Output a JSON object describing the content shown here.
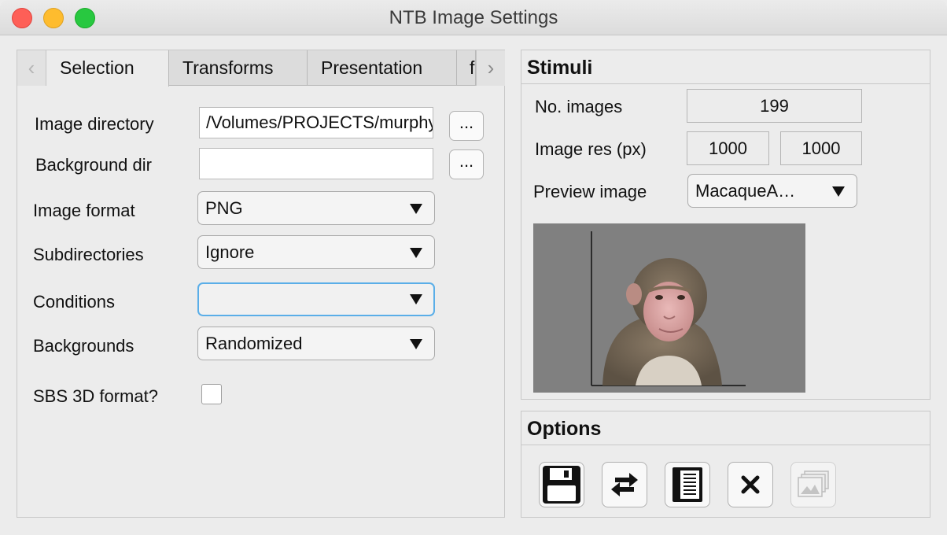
{
  "window": {
    "title": "NTB Image Settings"
  },
  "tabs": [
    {
      "label": "Selection"
    },
    {
      "label": "Transforms"
    },
    {
      "label": "Presentation"
    },
    {
      "label": "f"
    }
  ],
  "selection": {
    "image_directory": {
      "label": "Image directory",
      "value": "/Volumes/PROJECTS/murphya/Stimuli/",
      "browse": "..."
    },
    "background_dir": {
      "label": "Background dir",
      "value": "",
      "browse": "..."
    },
    "image_format": {
      "label": "Image format",
      "value": "PNG"
    },
    "subdirectories": {
      "label": "Subdirectories",
      "value": "Ignore"
    },
    "conditions": {
      "label": "Conditions",
      "value": ""
    },
    "backgrounds": {
      "label": "Backgrounds",
      "value": "Randomized"
    },
    "sbs3d": {
      "label": "SBS 3D format?",
      "checked": false
    }
  },
  "stimuli": {
    "title": "Stimuli",
    "num_images_label": "No. images",
    "num_images": "199",
    "res_label": "Image res (px)",
    "res_x": "1000",
    "res_y": "1000",
    "preview_label": "Preview image",
    "preview_value": "MacaqueA…"
  },
  "options": {
    "title": "Options",
    "buttons": [
      {
        "icon": "save-icon",
        "enabled": true
      },
      {
        "icon": "swap-arrows-icon",
        "enabled": true
      },
      {
        "icon": "book-icon",
        "enabled": true
      },
      {
        "icon": "close-icon",
        "enabled": true
      },
      {
        "icon": "image-stack-icon",
        "enabled": false
      }
    ]
  },
  "colors": {
    "focus": "#5aaee8",
    "preview_bg": "#808080"
  }
}
